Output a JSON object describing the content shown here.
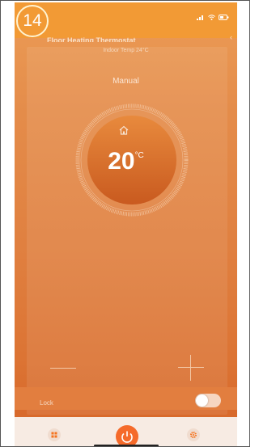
{
  "badge": {
    "number": "14"
  },
  "header": {
    "title": "Floor Heating Thermostat"
  },
  "indoor": {
    "label": "Indoor Temp 24°C"
  },
  "mode": {
    "label": "Manual"
  },
  "temperature": {
    "value": "20",
    "unit": "°C"
  },
  "lock": {
    "label": "Lock",
    "state": "off"
  },
  "colors": {
    "accent": "#f29a35",
    "power": "#f56a2a",
    "background_top": "#ec9c56",
    "background_bottom": "#d86a2c"
  },
  "icons": {
    "home": "home-icon",
    "grid": "grid-icon",
    "power": "power-icon",
    "settings": "gear-icon"
  }
}
